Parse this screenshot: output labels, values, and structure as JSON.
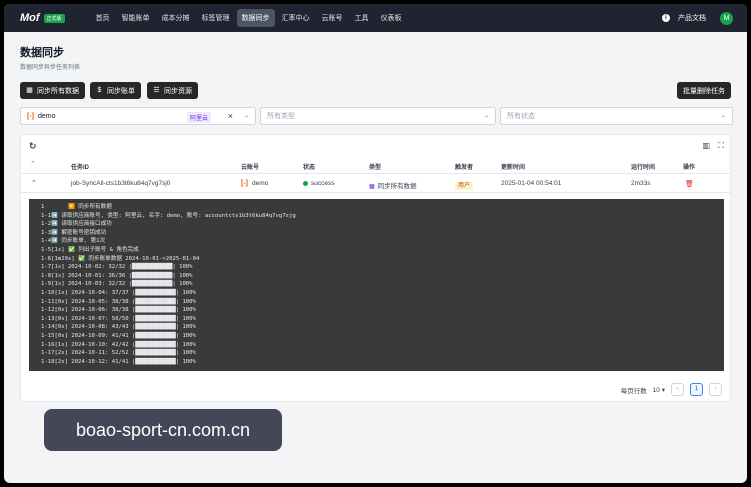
{
  "app": {
    "logo": "Mof",
    "env_badge": "正式版"
  },
  "nav": {
    "items": [
      "首页",
      "智能账单",
      "成本分摊",
      "标签管理",
      "数据同步",
      "汇率中心",
      "云账号",
      "工具",
      "仪表板"
    ],
    "active_index": 4,
    "docs_label": "产品文档",
    "avatar_initial": "M"
  },
  "page": {
    "title": "数据同步",
    "subtitle": "数据同步异步任务列表"
  },
  "actions": {
    "sync_all": "同步所有数据",
    "sync_bill": "同步账单",
    "sync_resource": "同步资源",
    "bulk_delete": "批量删除任务"
  },
  "filters": {
    "account_value": "demo",
    "account_cloud": "阿里云",
    "type_placeholder": "所有类型",
    "status_placeholder": "所有状态"
  },
  "table": {
    "headers": [
      "任务ID",
      "云账号",
      "状态",
      "类型",
      "触发者",
      "更新时间",
      "运行时间",
      "操作"
    ],
    "row": {
      "task_id": "job-SyncAll-cts1b3t6ku84q7vg7sj0",
      "account": "demo",
      "status": "success",
      "type": "同步所有数据",
      "trigger": "用户",
      "updated": "2025-01-04 00:54:01",
      "runtime": "2m33s"
    }
  },
  "log": [
    "1       ▶️ 同步所有数据",
    "1-1➡️ 读取供应商账号, 类型: 阿里云, 名字: demo, 账号: accountcts1b3t6ku84q7vg7sjg",
    "1-2➡️ 读取供应商接口成功",
    "1-3➡️ 解密账号密钥成功",
    "1-4➡️ 同步账单, 第1次",
    "1-5[1s] ✅ 列出子账号 & 角色完成",
    "1-6[1m29s] ✅ 同步账单数据 2024-10-01->2025-01-04",
    "1-7[1s] 2024-10-02: 32/32 |████████████| 100%",
    "1-8[1s] 2024-10-01: 36/36 |████████████| 100%",
    "1-9[1s] 2024-10-03: 32/32 |████████████| 100%",
    "1-10[1s] 2024-10-04: 37/37 |████████████| 100%",
    "1-11[0s] 2024-10-05: 38/38 |████████████| 100%",
    "1-12[0s] 2024-10-06: 38/38 |████████████| 100%",
    "1-13[0s] 2024-10-07: 50/50 |████████████| 100%",
    "1-14[0s] 2024-10-08: 43/43 |████████████| 100%",
    "1-15[0s] 2024-10-09: 41/41 |████████████| 100%",
    "1-16[1s] 2024-10-10: 42/42 |████████████| 100%",
    "1-17[2s] 2024-10-11: 52/52 |████████████| 100%",
    "1-18[2s] 2024-10-12: 41/41 |████████████| 100%"
  ],
  "pager": {
    "rows_label": "每页行数",
    "page_size": "10",
    "current_page": "1"
  },
  "watermark": "boao-sport-cn.com.cn",
  "colors": {
    "nav_bg": "#1f2430",
    "success": "#16a34a",
    "danger": "#dc2626",
    "cloud_tag": "#6d28d9",
    "terminal_bg": "#3a3a3a"
  }
}
